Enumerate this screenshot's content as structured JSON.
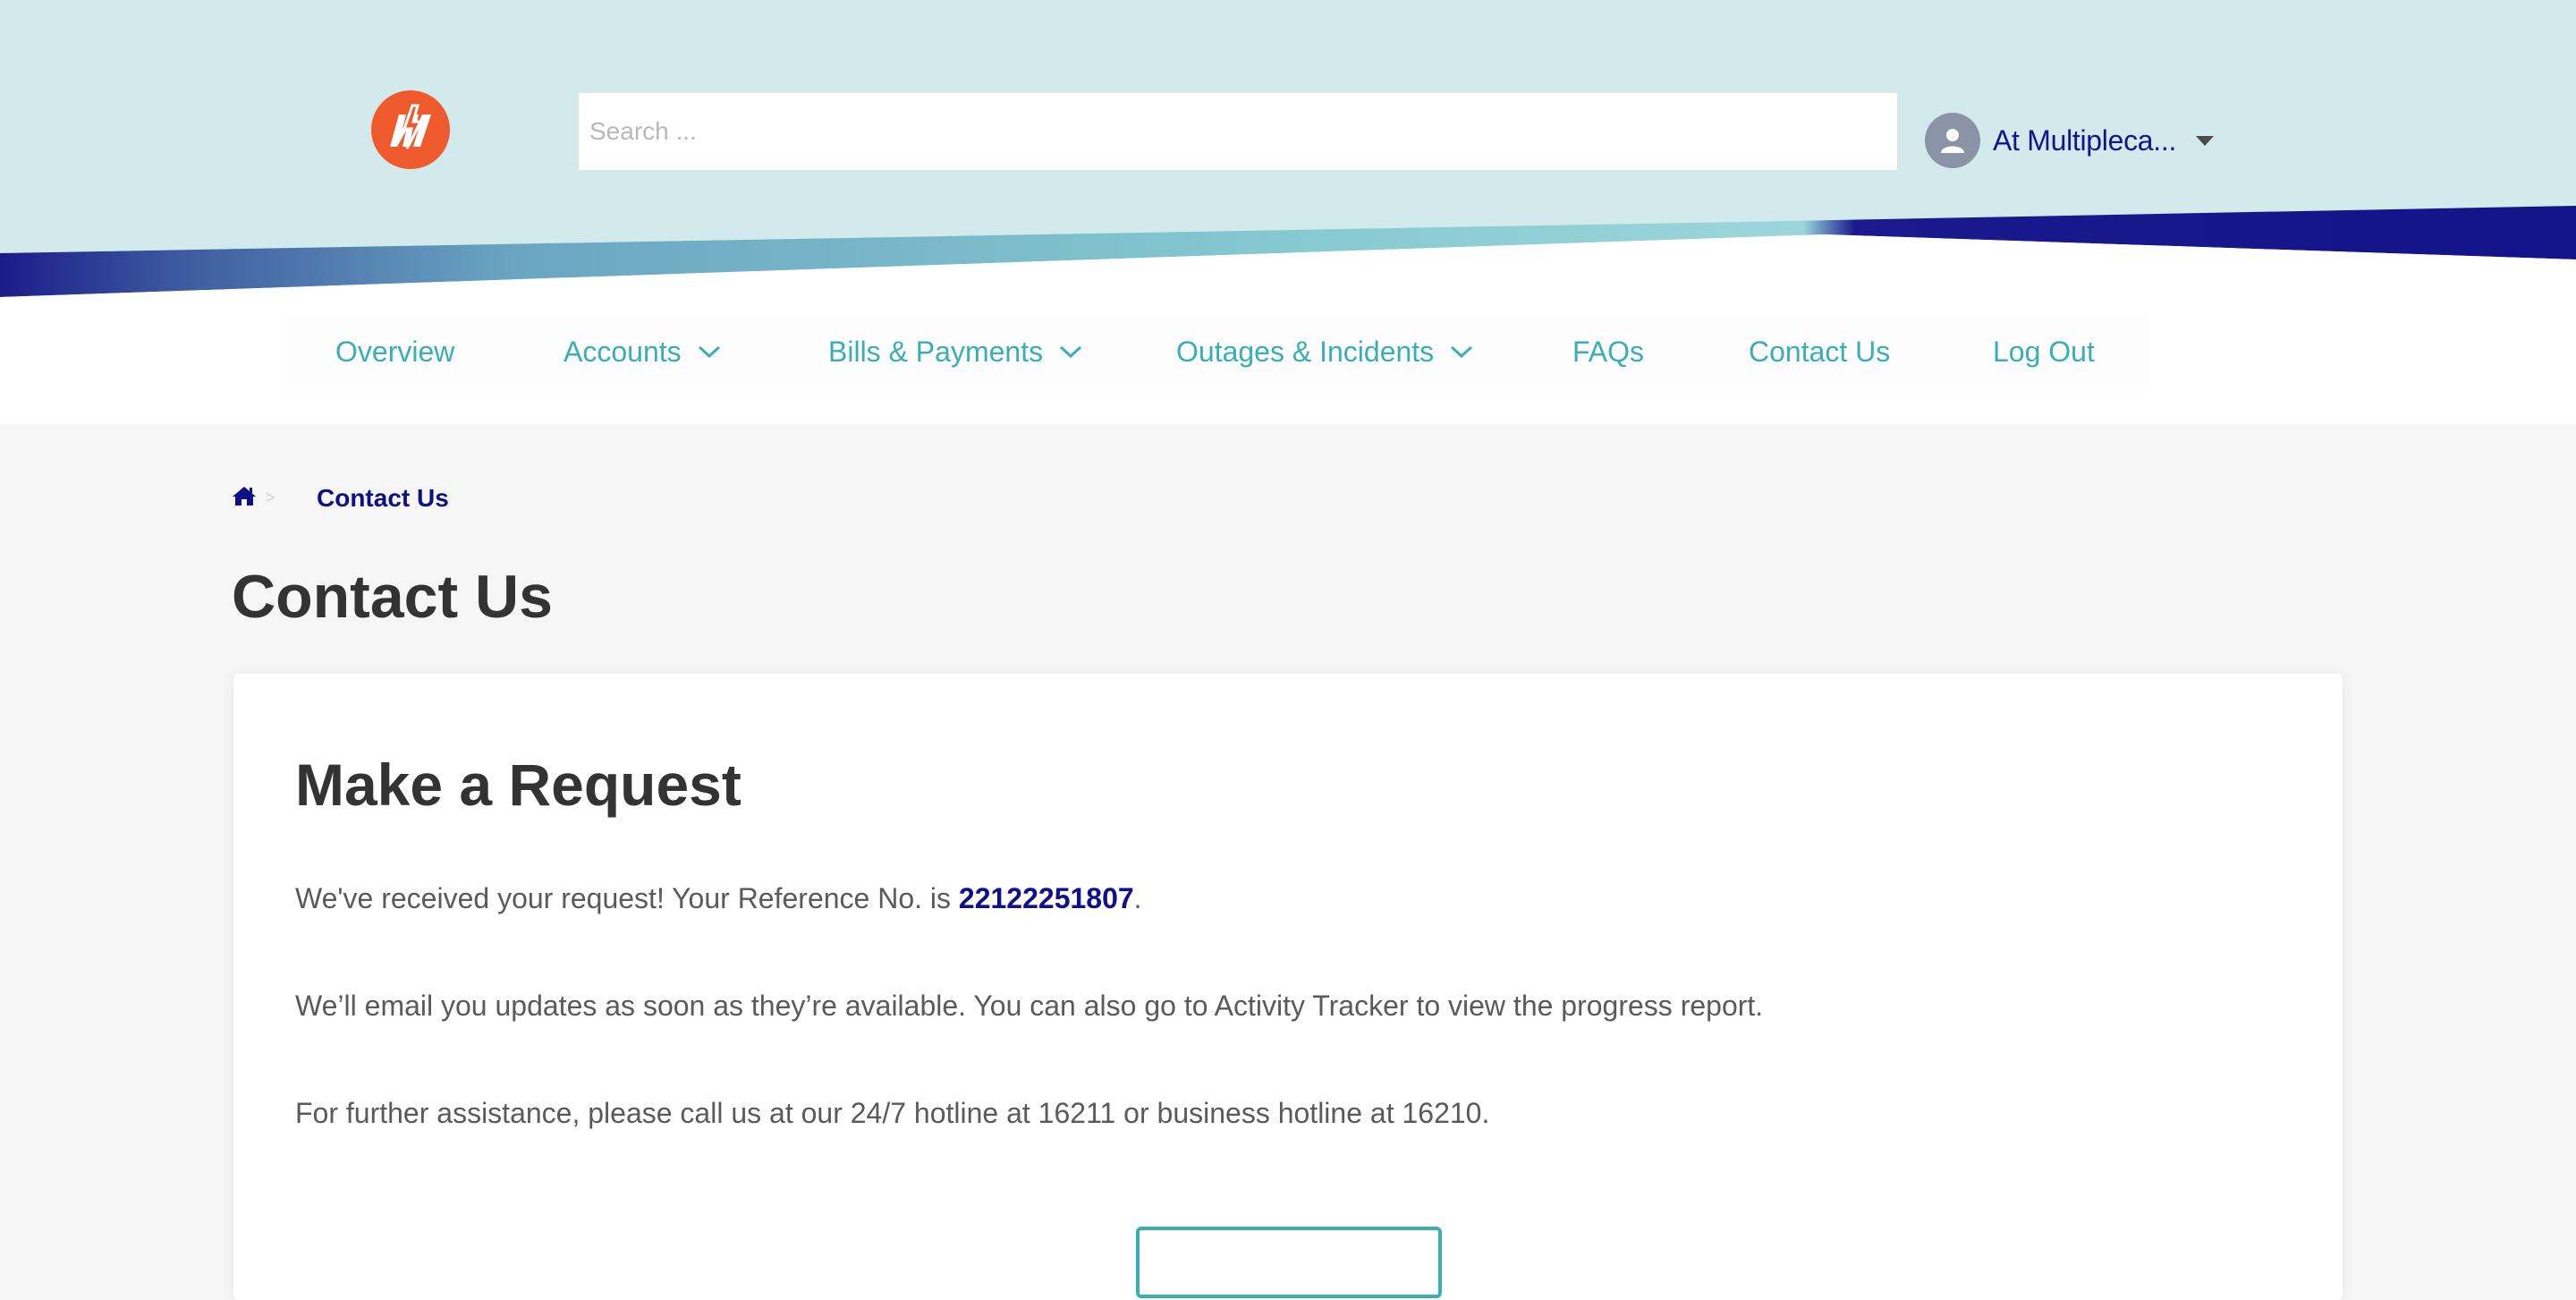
{
  "header": {
    "logo_alt": "Logo",
    "search": {
      "placeholder": "Search ...",
      "value": ""
    },
    "user": {
      "name": "At Multipleca..."
    }
  },
  "nav": {
    "items": [
      {
        "label": "Overview"
      },
      {
        "label": "Accounts"
      },
      {
        "label": "Bills & Payments"
      },
      {
        "label": "Outages & Incidents"
      },
      {
        "label": "FAQs"
      },
      {
        "label": "Contact Us"
      },
      {
        "label": "Log Out"
      }
    ]
  },
  "breadcrumb": {
    "separator": ">",
    "current": "Contact Us"
  },
  "page": {
    "title": "Contact Us"
  },
  "card": {
    "title": "Make a Request",
    "received_prefix": "We've received your request! Your Reference No. is ",
    "reference_no": "22122251807",
    "received_suffix": ".",
    "updates_text": "We’ll email you updates as soon as they’re available. You can also go to Activity Tracker to view the progress report.",
    "assistance_text": "For further assistance, please call us at our 24/7 hotline at 16211 or business hotline at 16210.",
    "button_label": ""
  },
  "colors": {
    "header_bg": "#d3eaec",
    "brand_navy": "#14148c",
    "brand_teal": "#3aaeb6",
    "logo_orange": "#ee5a2c"
  },
  "icons": {
    "logo": "lightning-bolt-logo",
    "user": "user-avatar-icon",
    "menu_caret": "caret-down-icon",
    "nav_chevron": "chevron-down-icon",
    "home": "home-icon"
  }
}
